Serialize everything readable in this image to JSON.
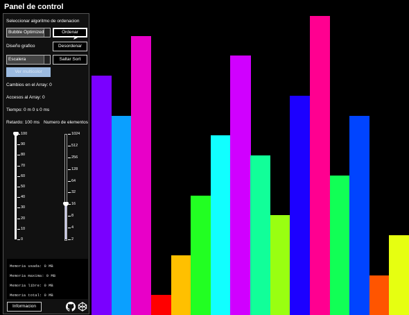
{
  "title": "Panel de control",
  "algo_section_label": "Seleccionar algoritmo de ordenacion",
  "algo_combo_value": "Bubble Optimized",
  "sort_button": "Ordenar",
  "design_label": "Diseño grafico",
  "shuffle_button": "Desordenar",
  "design_combo_value": "Escalera",
  "skip_button": "Saltar Sort",
  "multicolor_button": "Ver multicolor",
  "stats": {
    "changes": "Cambios en el Array: 0",
    "accesses": "Accesos al Array: 0",
    "time": "Tiempo: 0 m 0 s 0 ms"
  },
  "delay": {
    "label": "Retardo: 100 ms",
    "ticks": [
      "100",
      "90",
      "80",
      "70",
      "60",
      "50",
      "40",
      "30",
      "20",
      "10",
      "0"
    ],
    "value_fraction": 1.0
  },
  "elements": {
    "label": "Numero de elementos",
    "ticks": [
      "1024",
      "512",
      "256",
      "128",
      "64",
      "32",
      "16",
      "8",
      "4",
      "2"
    ],
    "selected": "16"
  },
  "memory": {
    "used": "Memoria usada: 0 MB",
    "max": "Memoria maxima: 0 MB",
    "free": "Memoria libre: 0 MB",
    "total": "Memoria total: 0 MB"
  },
  "info_button": "Informacion",
  "icons": [
    "github-icon",
    "codepen-icon"
  ],
  "chart_data": {
    "type": "bar",
    "values": [
      12,
      10,
      14,
      1,
      3,
      6,
      9,
      13,
      8,
      5,
      11,
      15,
      7,
      10,
      2,
      4
    ],
    "colors": [
      "#7a00ff",
      "#0aa0ff",
      "#e800c8",
      "#ff0000",
      "#ffc000",
      "#22ff22",
      "#11ffff",
      "#d000ff",
      "#11ff99",
      "#99ff11",
      "#1c00ff",
      "#ff0090",
      "#11ff55",
      "#0044ff",
      "#ff5500",
      "#e6ff11"
    ],
    "ylim": [
      0,
      15.8
    ]
  }
}
